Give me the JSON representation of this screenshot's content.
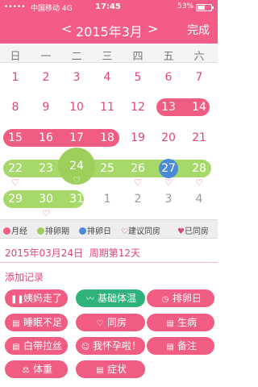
{
  "status_bar": {
    "signal": "•••••",
    "carrier": "中国移动  4G",
    "time": "17:45",
    "battery": "53%"
  },
  "nav": {
    "prev": "<",
    "title": "2015年3月",
    "next": ">",
    "done": "完成"
  },
  "weekdays": [
    "日",
    "一",
    "二",
    "三",
    "四",
    "五",
    "六"
  ],
  "calendar": {
    "rows": [
      [
        "1",
        "2",
        "3",
        "4",
        "5",
        "6",
        "7"
      ],
      [
        "8",
        "9",
        "10",
        "11",
        "12",
        "13",
        "14"
      ],
      [
        "15",
        "16",
        "17",
        "18",
        "19",
        "20",
        "21"
      ],
      [
        "22",
        "23",
        "24",
        "25",
        "26",
        "27",
        "28"
      ],
      [
        "29",
        "30",
        "31",
        "1",
        "2",
        "3",
        "4"
      ]
    ],
    "heart": "♡"
  },
  "legend": {
    "period": "月经",
    "ovulation_period": "排卵期",
    "ovulation_day": "排卵日",
    "suggest": "建议同房",
    "done": "已同房"
  },
  "selected": {
    "date": "2015年03月24日",
    "cycle": "周期第12天"
  },
  "records": {
    "title": "添加记录",
    "buttons": [
      "姨妈走了",
      "基础体温",
      "排卵日",
      "睡眠不足",
      "同房",
      "生病",
      "白带拉丝",
      "我怀孕啦！",
      "备注",
      "体重",
      "症状"
    ]
  },
  "colors": {
    "primary": "#f25c86",
    "ovulation_green": "#a6d96a",
    "ovulation_day_blue": "#4a8ad6",
    "temp_button": "#2fb37a"
  }
}
